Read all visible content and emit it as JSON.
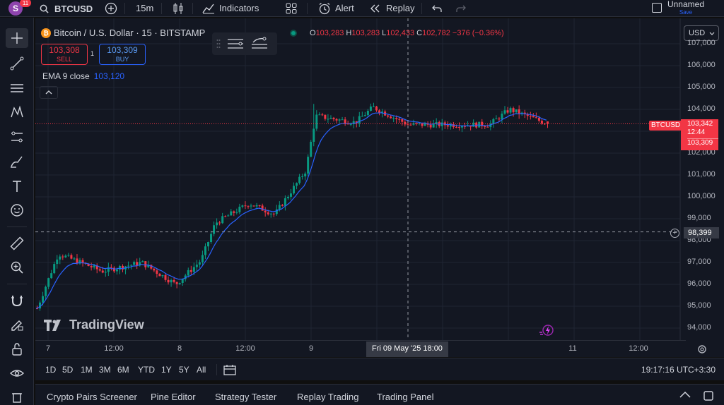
{
  "topbar": {
    "avatar_letter": "S",
    "notification_count": "11",
    "symbol": "BTCUSD",
    "interval": "15m",
    "indicators_label": "Indicators",
    "alert_label": "Alert",
    "replay_label": "Replay",
    "layout_name": "Unnamed",
    "save_label": "Save"
  },
  "legend": {
    "title": "Bitcoin / U.S. Dollar · 15 · BITSTAMP",
    "open_key": "O",
    "open": "103,283",
    "high_key": "H",
    "high": "103,283",
    "low_key": "L",
    "low": "102,433",
    "close_key": "C",
    "close": "102,782",
    "change": "−376 (−0.36%)",
    "sell_price": "103,308",
    "sell_label": "SELL",
    "buy_price": "103,309",
    "buy_label": "BUY",
    "spread": "1",
    "ema_label": "EMA 9 close",
    "ema_value": "103,120"
  },
  "watermark": "TradingView",
  "currency": "USD",
  "price_axis": {
    "labels": [
      "107,000",
      "106,000",
      "105,000",
      "104,000",
      "103,000",
      "102,000",
      "101,000",
      "100,000",
      "99,000",
      "98,000",
      "97,000",
      "96,000",
      "95,000",
      "94,000"
    ],
    "ticker": "BTCUSD",
    "last_price": "103,342",
    "countdown": "12:44",
    "bid_price": "103,309",
    "crosshair_price": "98,399"
  },
  "time_axis": {
    "labels": [
      "7",
      "12:00",
      "8",
      "12:00",
      "9",
      "12:00",
      "11",
      "12:00"
    ],
    "crosshair_time": "Fri 09 May '25   18:00"
  },
  "range_bar": {
    "ranges": [
      "1D",
      "5D",
      "1M",
      "3M",
      "6M",
      "YTD",
      "1Y",
      "5Y",
      "All"
    ],
    "clock": "19:17:16 UTC+3:30"
  },
  "bottom_tabs": [
    "Crypto Pairs Screener",
    "Pine Editor",
    "Strategy Tester",
    "Replay Trading",
    "Trading Panel"
  ],
  "colors": {
    "up": "#089981",
    "down": "#f23645",
    "ema": "#2962ff",
    "background": "#131722"
  },
  "chart_data": {
    "type": "candlestick",
    "symbol": "BTCUSD",
    "interval": "15",
    "ylim": [
      93700,
      107300
    ],
    "y_ticks": [
      94000,
      95000,
      96000,
      97000,
      98000,
      99000,
      100000,
      101000,
      102000,
      103000,
      104000,
      105000,
      106000,
      107000
    ],
    "x_ticks": [
      "7",
      "12:00",
      "8",
      "12:00",
      "9",
      "12:00",
      "11",
      "12:00"
    ],
    "key_points": [
      {
        "t": "May 7 00:00",
        "price": 94900
      },
      {
        "t": "May 7 04:00",
        "price": 97400
      },
      {
        "t": "May 7 12:00",
        "price": 96600
      },
      {
        "t": "May 7 20:00",
        "price": 97000
      },
      {
        "t": "May 8 00:00",
        "price": 96000
      },
      {
        "t": "May 8 08:00",
        "price": 97100
      },
      {
        "t": "May 8 10:00",
        "price": 98800
      },
      {
        "t": "May 8 14:00",
        "price": 99700
      },
      {
        "t": "May 8 20:00",
        "price": 99200
      },
      {
        "t": "May 9 00:00",
        "price": 101200
      },
      {
        "t": "May 9 01:00",
        "price": 103700
      },
      {
        "t": "May 9 08:00",
        "price": 103400
      },
      {
        "t": "May 9 12:00",
        "price": 104100
      },
      {
        "t": "May 9 18:00",
        "price": 103300
      },
      {
        "t": "May 10 12:00",
        "price": 103300
      },
      {
        "t": "May 10 20:00",
        "price": 104000
      },
      {
        "t": "May 11 00:00",
        "price": 103342
      }
    ],
    "ema_period": 9,
    "last": 103342,
    "crosshair": {
      "time": "Fri 09 May '25 18:00",
      "price": 98399
    }
  }
}
